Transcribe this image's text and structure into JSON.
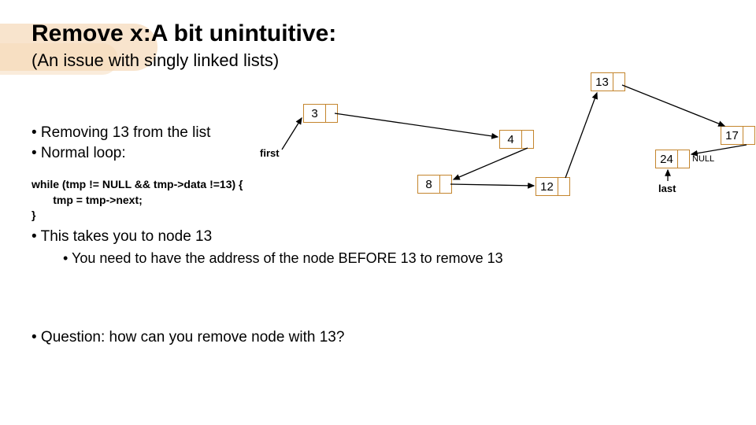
{
  "title": "Remove x:A bit unintuitive:",
  "subtitle": "(An issue with singly linked lists)",
  "bullets": {
    "b1": "• Removing 13 from the list",
    "b2": "• Normal loop:",
    "b3": "• This takes you to node 13",
    "b3sub": "• You need to have the address of the node BEFORE 13 to remove 13",
    "b4": "• Question: how can you remove node with 13?"
  },
  "code": "while (tmp != NULL && tmp->data !=13) {\n       tmp = tmp->next;\n}",
  "labels": {
    "first": "first",
    "last": "last",
    "null": "NULL"
  },
  "nodes": {
    "n3": "3",
    "n4": "4",
    "n8": "8",
    "n12": "12",
    "n13": "13",
    "n17": "17",
    "n24": "24"
  },
  "chart_data": {
    "type": "diagram",
    "structure": "singly-linked-list",
    "values": [
      3,
      4,
      8,
      12,
      13,
      17,
      24
    ],
    "first_pointer": 3,
    "last_pointer": 24,
    "target_remove": 13,
    "terminal": "NULL"
  }
}
